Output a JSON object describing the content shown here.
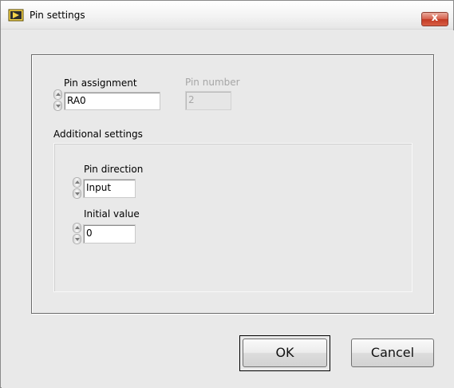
{
  "window": {
    "title": "Pin settings",
    "icon": "labview-vi-icon",
    "close_label": "x"
  },
  "pin_assignment": {
    "label": "Pin assignment",
    "value": "RA0"
  },
  "pin_number": {
    "label": "Pin number",
    "value": "2",
    "enabled": false
  },
  "additional_settings": {
    "label": "Additional settings",
    "pin_direction": {
      "label": "Pin direction",
      "value": "Input"
    },
    "initial_value": {
      "label": "Initial value",
      "value": "0"
    }
  },
  "buttons": {
    "ok_label": "OK",
    "cancel_label": "Cancel"
  },
  "colors": {
    "dialog_background": "#e9e9e9",
    "close_button": "#c23a24",
    "disabled_text": "#a6a6a6"
  }
}
